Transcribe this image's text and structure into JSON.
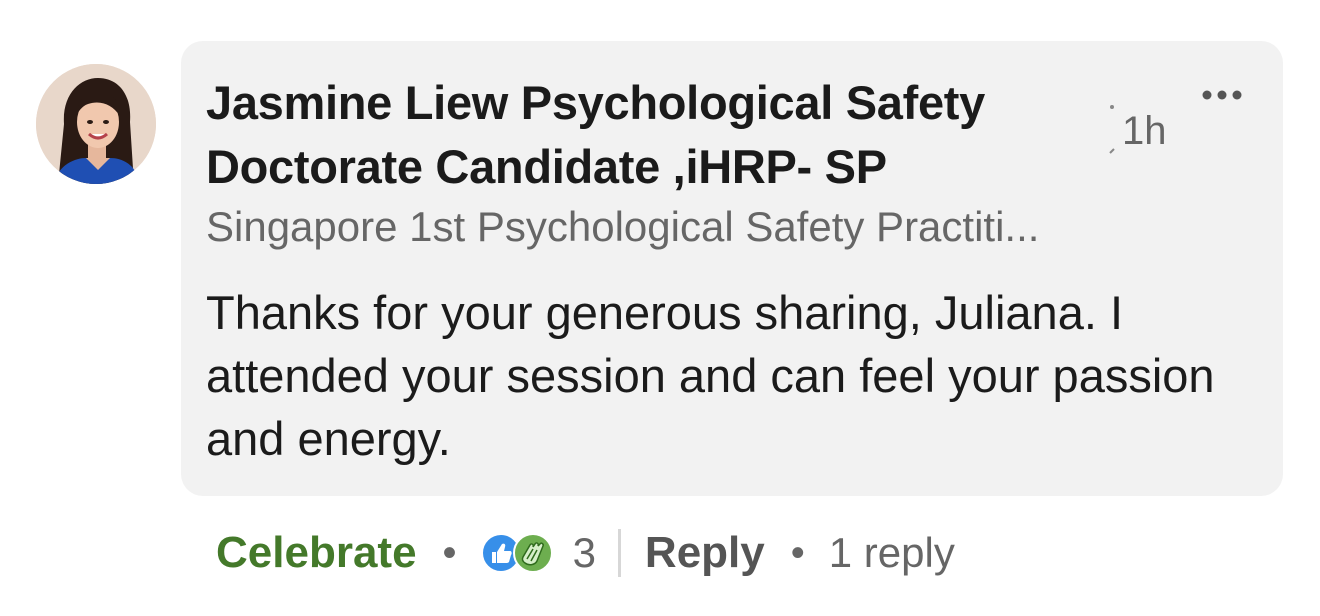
{
  "comment": {
    "author": {
      "name": "Jasmine Liew Psychological Safety Doctorate Candidate ,iHRP- SP",
      "headline": "Singapore 1st Psychological Safety Practiti...",
      "avatar_icon": "profile-photo"
    },
    "timestamp": "1h",
    "more_icon": "more-horizontal-icon",
    "text": "Thanks for your generous sharing, Juliana. I attended your session and can feel your passion and energy."
  },
  "actions": {
    "celebrate_label": "Celebrate",
    "separator": "•",
    "reactions": {
      "icons": [
        "like-icon",
        "celebrate-icon"
      ],
      "count": "3"
    },
    "reply_label": "Reply",
    "reply_count_label": "1 reply"
  },
  "colors": {
    "bubble_background": "#f2f2f2",
    "celebrate_green": "#44792a",
    "like_blue": "#378fe9",
    "secondary_text": "#666666",
    "primary_text": "#1b1b1b"
  }
}
